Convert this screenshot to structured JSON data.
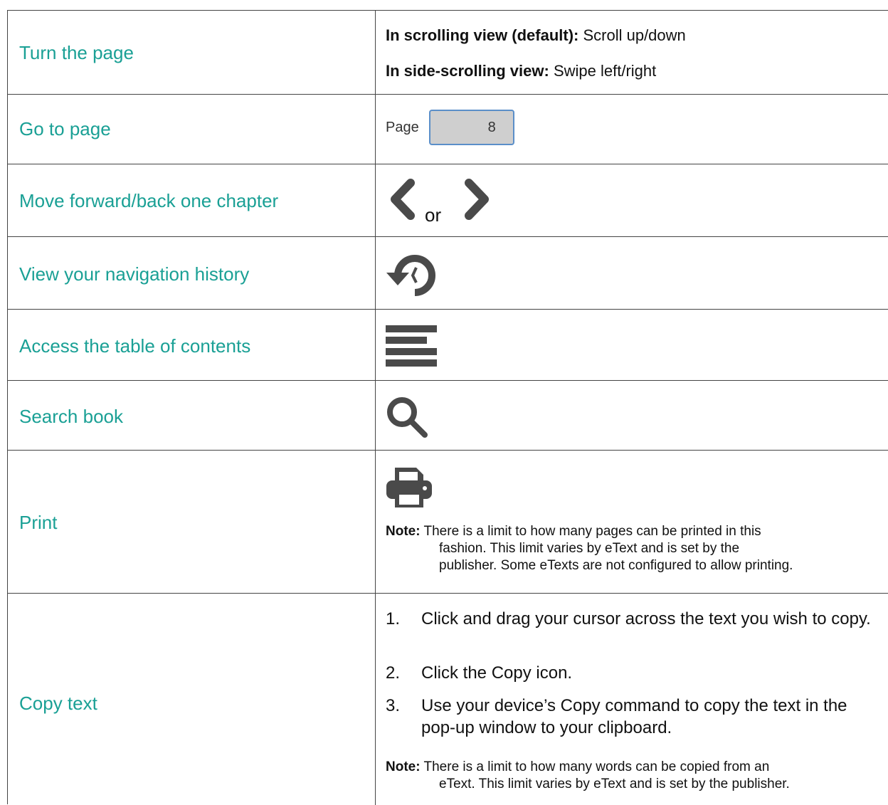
{
  "rows": {
    "turn_page": {
      "label": "Turn the page",
      "scroll_bold": "In scrolling view (default):",
      "scroll_text": " Scroll up/down",
      "side_bold": "In side-scrolling view:",
      "side_text": " Swipe left/right"
    },
    "go_to_page": {
      "label": "Go to page",
      "page_label": "Page",
      "page_value": "8"
    },
    "chapter": {
      "label": "Move forward/back one chapter",
      "or_text": "or",
      "icons": [
        "chevron-left-icon",
        "chevron-right-icon"
      ]
    },
    "history": {
      "label": "View your navigation history",
      "icon": "history-icon"
    },
    "toc": {
      "label": "Access the table of contents",
      "icon": "table-of-contents-icon"
    },
    "search": {
      "label": "Search book",
      "icon": "search-icon"
    },
    "print": {
      "label": "Print",
      "icon": "printer-icon",
      "note_bold": "Note:",
      "note_line1": " There is a limit to how many pages can be printed in this",
      "note_line2": "fashion. This limit varies by eText and is set by the",
      "note_line3": "publisher. Some eTexts are not configured to allow printing."
    },
    "copy": {
      "label": "Copy text",
      "steps": [
        {
          "num": "1.",
          "text": "Click and drag your cursor across the text you wish to copy."
        },
        {
          "num": "2.",
          "text": "Click the Copy icon."
        },
        {
          "num": "3.",
          "text": "Use your device’s Copy command to copy the text in the pop-up window to your clipboard."
        }
      ],
      "note_bold": "Note:",
      "note_line1": " There is a limit to how many words can be copied from an",
      "note_line2": "eText. This limit varies by eText and is set by the publisher."
    }
  },
  "colors": {
    "label": "#1aa095",
    "icon": "#4a4a4a",
    "border": "#444444"
  }
}
